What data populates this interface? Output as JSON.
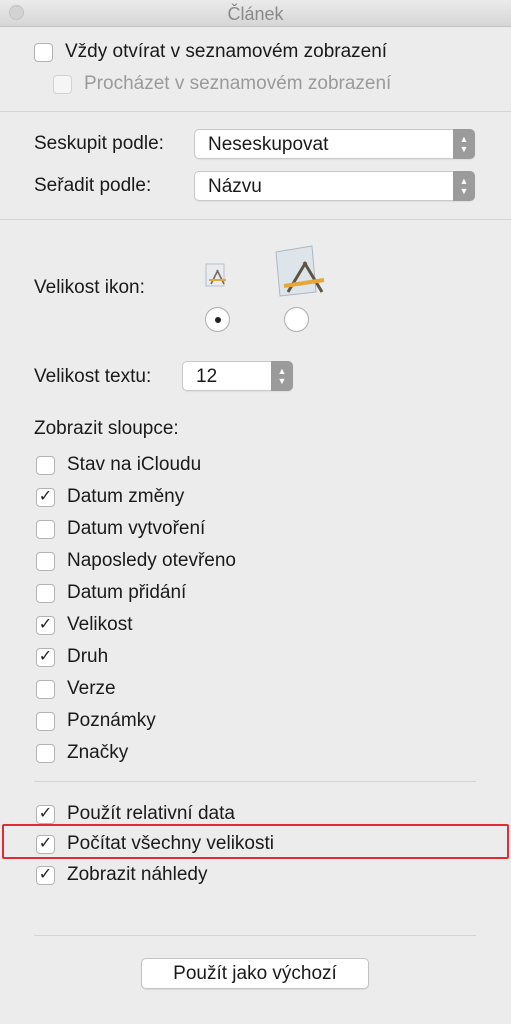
{
  "window": {
    "title": "Článek"
  },
  "list_view": {
    "always_open_label": "Vždy otvírat v seznamovém zobrazení",
    "always_open_checked": false,
    "browse_label": "Procházet v seznamovém zobrazení",
    "browse_checked": false
  },
  "group_by": {
    "label": "Seskupit podle:",
    "value": "Neseskupovat"
  },
  "sort_by": {
    "label": "Seřadit podle:",
    "value": "Názvu"
  },
  "icon_size": {
    "label": "Velikost ikon:",
    "selected": "small"
  },
  "text_size": {
    "label": "Velikost textu:",
    "value": "12"
  },
  "columns": {
    "label": "Zobrazit sloupce:",
    "items": [
      {
        "label": "Stav na iCloudu",
        "checked": false
      },
      {
        "label": "Datum změny",
        "checked": true
      },
      {
        "label": "Datum vytvoření",
        "checked": false
      },
      {
        "label": "Naposledy otevřeno",
        "checked": false
      },
      {
        "label": "Datum přidání",
        "checked": false
      },
      {
        "label": "Velikost",
        "checked": true
      },
      {
        "label": "Druh",
        "checked": true
      },
      {
        "label": "Verze",
        "checked": false
      },
      {
        "label": "Poznámky",
        "checked": false
      },
      {
        "label": "Značky",
        "checked": false
      }
    ]
  },
  "options": {
    "items": [
      {
        "label": "Použít relativní data",
        "checked": true
      },
      {
        "label": "Počítat všechny velikosti",
        "checked": true
      },
      {
        "label": "Zobrazit náhledy",
        "checked": true
      }
    ]
  },
  "default_button": {
    "label": "Použít jako výchozí"
  },
  "colors": {
    "highlight": "#e02c35",
    "stepper": "#9b9b9b",
    "background": "#ececec"
  },
  "icons": {
    "check": "✓",
    "stepper_up": "▲",
    "stepper_down": "▼"
  }
}
